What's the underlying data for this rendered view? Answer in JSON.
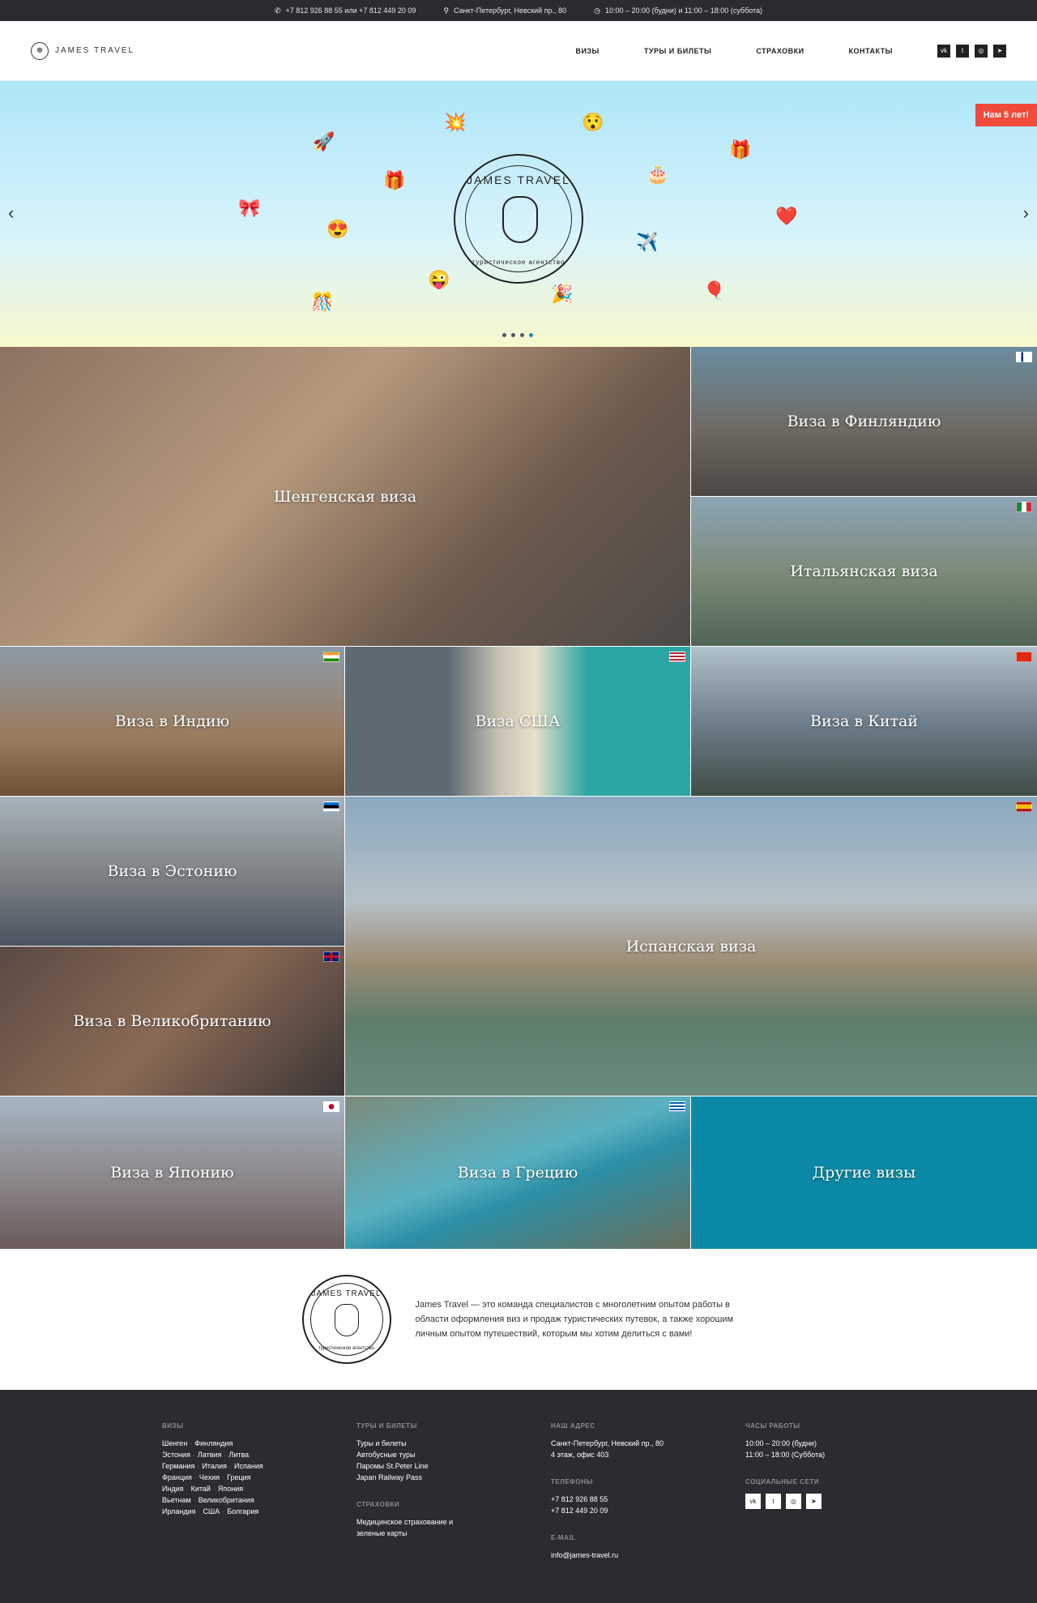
{
  "topbar": {
    "phone": "+7 812 926 88 55 или +7 812 449 20 09",
    "address": "Санкт-Петербург, Невский пр., 80",
    "hours": "10:00 – 20:00 (будни) и 11:00 – 18:00 (суббота)"
  },
  "header": {
    "logo_text": "JAMES TRAVEL",
    "nav": [
      "ВИЗЫ",
      "ТУРЫ И БИЛЕТЫ",
      "СТРАХОВКИ",
      "КОНТАКТЫ"
    ],
    "social": [
      "vk-icon",
      "twitter-icon",
      "instagram-icon",
      "telegram-icon"
    ]
  },
  "hero": {
    "badge": "Нам 5 лет!",
    "emblem_top": "JAMES TRAVEL",
    "emblem_bottom": "туристическое агентство",
    "slides": 4,
    "active_slide": 4
  },
  "tiles": [
    {
      "label": "Шенгенская виза",
      "flag": ""
    },
    {
      "label": "Виза в Финляндию",
      "flag": "finland"
    },
    {
      "label": "Итальянская виза",
      "flag": "italy"
    },
    {
      "label": "Виза в Индию",
      "flag": "india"
    },
    {
      "label": "Виза США",
      "flag": "usa"
    },
    {
      "label": "Виза в Китай",
      "flag": "china"
    },
    {
      "label": "Виза в Эстонию",
      "flag": "estonia"
    },
    {
      "label": "Испанская виза",
      "flag": "spain"
    },
    {
      "label": "Виза в Великобританию",
      "flag": "uk"
    },
    {
      "label": "Виза в Японию",
      "flag": "japan"
    },
    {
      "label": "Виза в Грецию",
      "flag": "greece"
    },
    {
      "label": "Другие визы",
      "flag": ""
    }
  ],
  "about": {
    "text": "James Travel — это команда специалистов с многолетним опытом работы в области оформления виз и продаж туристических путевок, а также хорошим личным опытом путешествий, которым мы хотим делиться с вами!"
  },
  "footer": {
    "visas": {
      "heading": "ВИЗЫ",
      "rows": [
        [
          "Шенген",
          "Финляндия"
        ],
        [
          "Эстония",
          "Латвия",
          "Литва"
        ],
        [
          "Германия",
          "Италия",
          "Испания"
        ],
        [
          "Франция",
          "Чехия",
          "Греция"
        ],
        [
          "Индия",
          "Китай",
          "Япония"
        ],
        [
          "Вьетнам",
          "Великобритания"
        ],
        [
          "Ирландия",
          "США",
          "Болгария"
        ]
      ]
    },
    "tours": {
      "heading": "ТУРЫ И БИЛЕТЫ",
      "items": [
        "Туры и билеты",
        "Автобусные туры",
        "Паромы St.Peter Line",
        "Japan Railway Pass"
      ]
    },
    "insurance": {
      "heading": "СТРАХОВКИ",
      "items": [
        "Медицинское страхование и",
        "зеленые карты"
      ]
    },
    "address": {
      "heading": "НАШ АДРЕС",
      "lines": [
        "Санкт-Петербург, Невский пр., 80",
        "4 этаж, офис 403"
      ]
    },
    "phones": {
      "heading": "ТЕЛЕФОНЫ",
      "lines": [
        "+7 812 926 88 55",
        "+7 812 449 20 09"
      ]
    },
    "email": {
      "heading": "E-MAIL",
      "value": "info@james-travel.ru"
    },
    "hours": {
      "heading": "ЧАСЫ РАБОТЫ",
      "lines": [
        "10:00 – 20:00 (будни)",
        "11:00 – 18:00 (Суббота)"
      ]
    },
    "social": {
      "heading": "СОЦИАЛЬНЫЕ СЕТИ",
      "icons": [
        "vk-icon",
        "twitter-icon",
        "instagram-icon",
        "telegram-icon"
      ]
    }
  }
}
